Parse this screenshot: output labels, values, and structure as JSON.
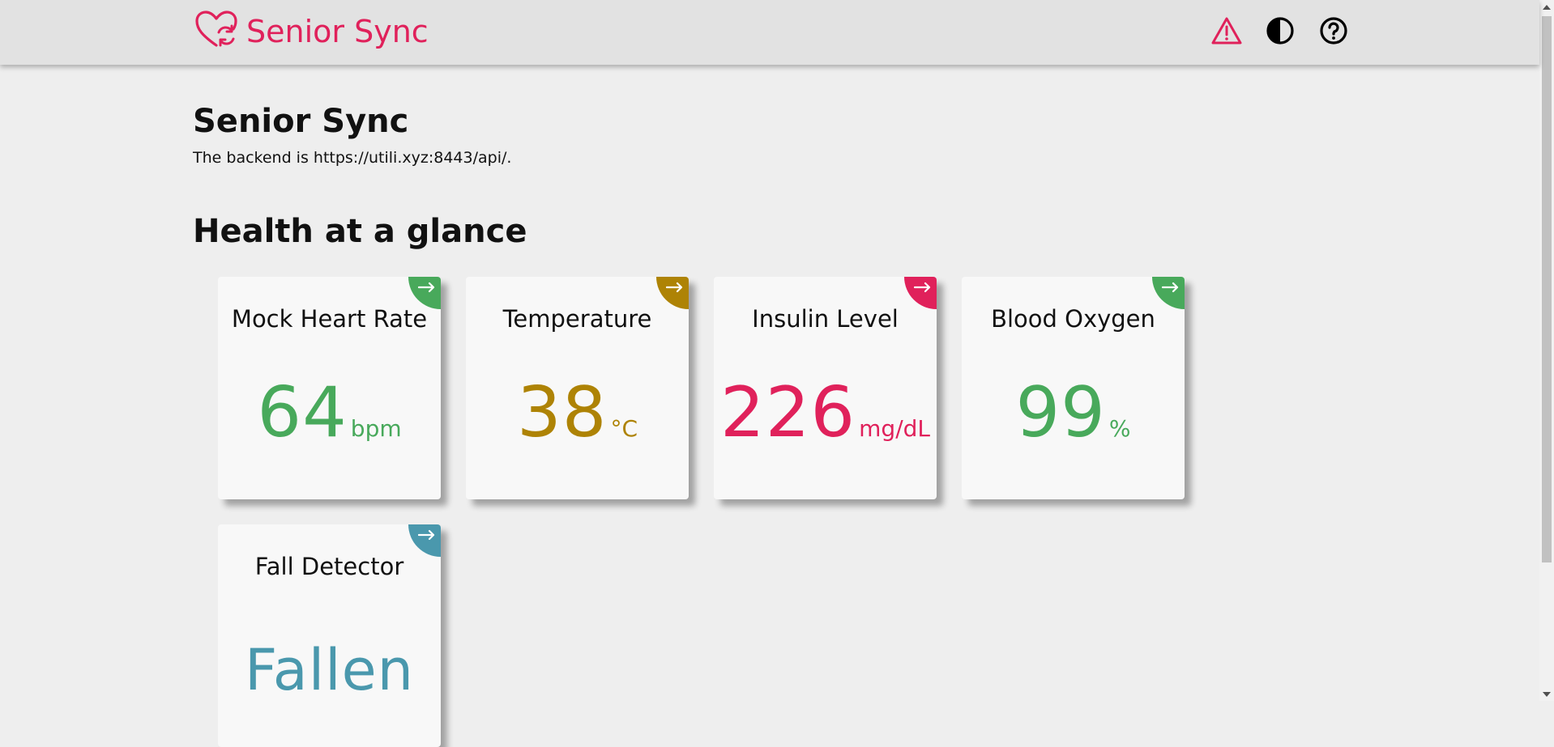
{
  "header": {
    "brand_text": "Senior Sync",
    "brand_color": "#e0215b",
    "icons": [
      "alert-triangle-icon",
      "contrast-icon",
      "help-circle-icon"
    ]
  },
  "main": {
    "title": "Senior Sync",
    "backend_text": "The backend is https://utili.xyz:8443/api/.",
    "section_title": "Health at a glance"
  },
  "cards": [
    {
      "title": "Mock Heart Rate",
      "value": "64",
      "unit": "bpm",
      "color": "#48a95b"
    },
    {
      "title": "Temperature",
      "value": "38",
      "unit": "°C",
      "color": "#ae8305"
    },
    {
      "title": "Insulin Level",
      "value": "226",
      "unit": "mg/dL",
      "color": "#e0215b"
    },
    {
      "title": "Blood Oxygen",
      "value": "99",
      "unit": "%",
      "color": "#48a95b"
    },
    {
      "title": "Fall Detector",
      "value": "Fallen",
      "unit": "",
      "color": "#4a98ad"
    }
  ]
}
